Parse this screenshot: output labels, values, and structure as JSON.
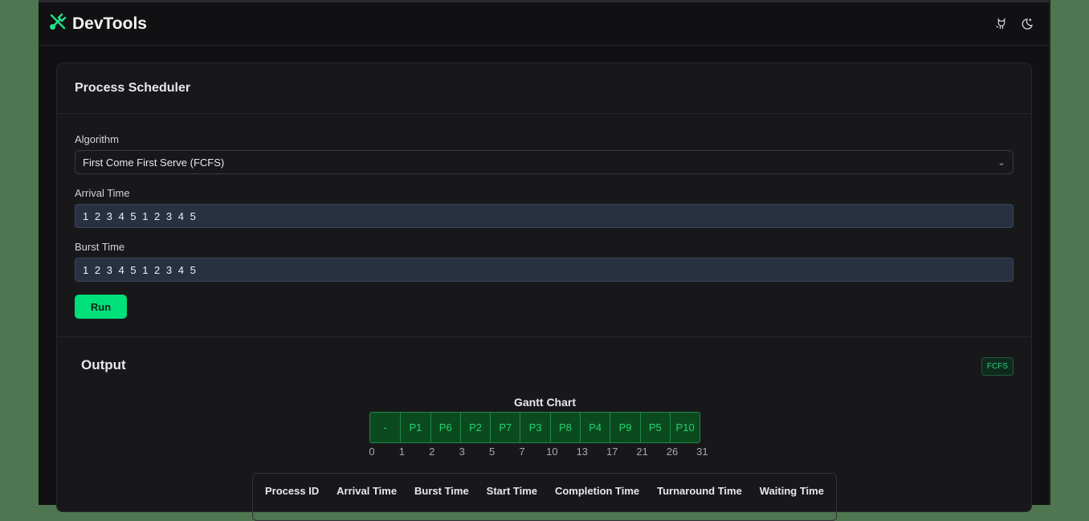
{
  "app": {
    "title": "DevTools",
    "icons": [
      "tools-icon",
      "github-icon",
      "moon-icon"
    ]
  },
  "card": {
    "title": "Process Scheduler"
  },
  "form": {
    "algorithm_label": "Algorithm",
    "algorithm_value": "First Come First Serve (FCFS)",
    "arrival_label": "Arrival Time",
    "arrival_value": "1 2 3 4 5 1 2 3 4 5",
    "burst_label": "Burst Time",
    "burst_value": "1 2 3 4 5 1 2 3 4 5",
    "run_label": "Run"
  },
  "output": {
    "title": "Output",
    "badge": "FCFS",
    "gantt_title": "Gantt Chart",
    "gantt": [
      "-",
      "P1",
      "P6",
      "P2",
      "P7",
      "P3",
      "P8",
      "P4",
      "P9",
      "P5",
      "P10"
    ],
    "ticks": [
      "0",
      "1",
      "2",
      "3",
      "5",
      "7",
      "10",
      "13",
      "17",
      "21",
      "26",
      "31"
    ],
    "columns": [
      "Process ID",
      "Arrival Time",
      "Burst Time",
      "Start Time",
      "Completion Time",
      "Turnaround Time",
      "Waiting Time"
    ]
  },
  "colors": {
    "accent": "#00e07a",
    "side": "#4e7650"
  }
}
